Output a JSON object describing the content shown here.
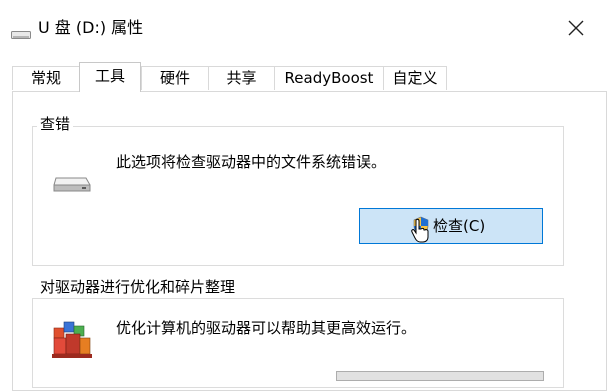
{
  "window": {
    "title": "U 盘 (D:) 属性",
    "icon": "drive-icon",
    "close_icon": "close-icon"
  },
  "tabs": [
    {
      "label": "常规",
      "active": false
    },
    {
      "label": "工具",
      "active": true
    },
    {
      "label": "硬件",
      "active": false
    },
    {
      "label": "共享",
      "active": false
    },
    {
      "label": "ReadyBoost",
      "active": false
    },
    {
      "label": "自定义",
      "active": false
    }
  ],
  "error_check": {
    "title": "查错",
    "description": "此选项将检查驱动器中的文件系统错误。",
    "button_label": "检查(C)",
    "icon": "drive-icon",
    "button_icon": "uac-shield-icon"
  },
  "optimize": {
    "title": "对驱动器进行优化和碎片整理",
    "description": "优化计算机的驱动器可以帮助其更高效运行。",
    "icon": "defrag-icon"
  },
  "colors": {
    "button_fill": "#cce4f7",
    "button_border": "#0078d7"
  }
}
